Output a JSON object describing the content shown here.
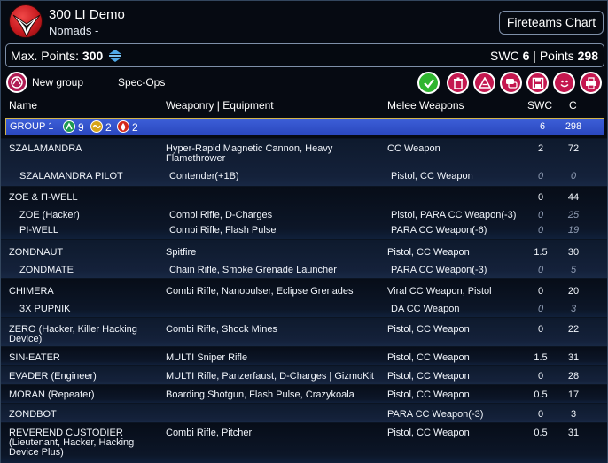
{
  "header": {
    "army_name": "300 LI Demo",
    "faction_name": "Nomads -",
    "fireteams_button": "Fireteams Chart"
  },
  "points_bar": {
    "max_label": "Max. Points:",
    "max_value": "300",
    "swc_label": "SWC",
    "swc_value": "6",
    "sep": "|",
    "points_label": "Points",
    "points_value": "298"
  },
  "toolbar": {
    "new_group_label": "New group",
    "spec_ops_label": "Spec-Ops",
    "icons": [
      "validate-check-icon",
      "trash-icon",
      "army-logo-icon",
      "chat-icon",
      "save-icon",
      "smiley-icon",
      "print-icon"
    ],
    "colors": {
      "green": "#2fb52f",
      "magenta": "#c4174f"
    }
  },
  "columns": {
    "name": "Name",
    "weaponry": "Weaponry | Equipment",
    "melee": "Melee Weapons",
    "swc": "SWC",
    "cost": "C"
  },
  "group": {
    "label": "GROUP 1",
    "regular_count": "9",
    "irregular_count": "2",
    "impetuous_count": "2",
    "swc": "6",
    "points": "298"
  },
  "units": [
    {
      "name": "SZALAMANDRA",
      "weapons": "Hyper-Rapid Magnetic Cannon, Heavy Flamethrower",
      "melee": "CC Weapon",
      "swc": "2",
      "points": "72",
      "subs": [
        {
          "name": "SZALAMANDRA PILOT",
          "weapons": "Contender(+1B)",
          "melee": "Pistol, CC Weapon",
          "swc": "0",
          "points": "0"
        }
      ]
    },
    {
      "name": "ZOE & Π-WELL",
      "weapons": "",
      "melee": "",
      "swc": "0",
      "points": "44",
      "subs": [
        {
          "name": "ZOE (Hacker)",
          "weapons": "Combi Rifle, D-Charges",
          "melee": "Pistol, PARA CC Weapon(-3)",
          "swc": "0",
          "points": "25"
        },
        {
          "name": "PI-WELL",
          "weapons": "Combi Rifle, Flash Pulse",
          "melee": "PARA CC Weapon(-6)",
          "swc": "0",
          "points": "19"
        }
      ]
    },
    {
      "name": "ZONDNAUT",
      "weapons": "Spitfire",
      "melee": "Pistol, CC Weapon",
      "swc": "1.5",
      "points": "30",
      "subs": [
        {
          "name": "ZONDMATE",
          "weapons": "Chain Rifle, Smoke Grenade Launcher",
          "melee": "PARA CC Weapon(-3)",
          "swc": "0",
          "points": "5"
        }
      ]
    },
    {
      "name": "CHIMERA",
      "weapons": "Combi Rifle, Nanopulser, Eclipse Grenades",
      "melee": "Viral CC Weapon, Pistol",
      "swc": "0",
      "points": "20",
      "subs": [
        {
          "name": "3X PUPNIK",
          "weapons": "",
          "melee": "DA CC Weapon",
          "swc": "0",
          "points": "3"
        }
      ]
    },
    {
      "name": "ZERO (Hacker, Killer Hacking Device)",
      "weapons": "Combi Rifle, Shock Mines",
      "melee": "Pistol, CC Weapon",
      "swc": "0",
      "points": "22",
      "subs": []
    },
    {
      "name": "SIN-EATER",
      "weapons": "MULTI Sniper Rifle",
      "melee": "Pistol, CC Weapon",
      "swc": "1.5",
      "points": "31",
      "subs": []
    },
    {
      "name": "EVADER (Engineer)",
      "weapons": "MULTI Rifle, Panzerfaust, D-Charges | GizmoKit",
      "melee": "Pistol, CC Weapon",
      "swc": "0",
      "points": "28",
      "subs": []
    },
    {
      "name": "MORAN (Repeater)",
      "weapons": "Boarding Shotgun, Flash Pulse, Crazykoala",
      "melee": "Pistol, CC Weapon",
      "swc": "0.5",
      "points": "17",
      "subs": []
    },
    {
      "name": "ZONDBOT",
      "weapons": "",
      "melee": "PARA CC Weapon(-3)",
      "swc": "0",
      "points": "3",
      "subs": []
    },
    {
      "name": "REVEREND CUSTODIER (Lieutenant, Hacker, Hacking Device Plus)",
      "weapons": "Combi Rifle, Pitcher",
      "melee": "Pistol, CC Weapon",
      "swc": "0.5",
      "points": "31",
      "subs": []
    }
  ]
}
